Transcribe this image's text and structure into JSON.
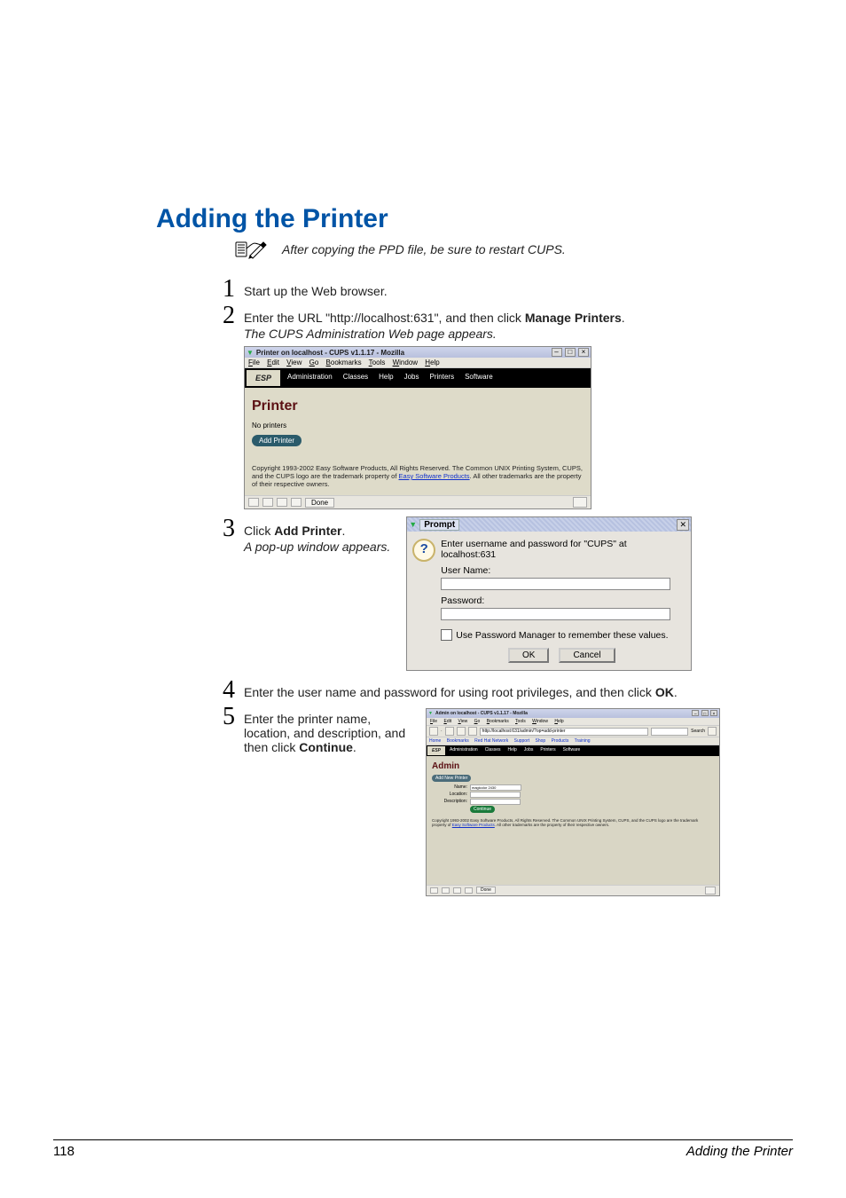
{
  "page": {
    "heading": "Adding the Printer",
    "note_after_icon": "After copying the PPD file, be sure to restart CUPS.",
    "footer_pagenum": "118",
    "footer_title": "Adding the Printer"
  },
  "steps": {
    "s1_num": "1",
    "s1_text": "Start up the Web browser.",
    "s2_num": "2",
    "s2_text_a": "Enter the URL \"http://localhost:631\", and then click ",
    "s2_bold": "Manage Printers",
    "s2_text_b": ".",
    "s2_result": "The CUPS Administration Web page appears.",
    "s3_num": "3",
    "s3_text_a": "Click ",
    "s3_bold": "Add Printer",
    "s3_text_b": ".",
    "s3_result": "A pop-up window appears.",
    "s4_num": "4",
    "s4_text_a": "Enter the user name and password for using root privileges, and then click ",
    "s4_bold": "OK",
    "s4_text_b": ".",
    "s5_num": "5",
    "s5_text_a": "Enter the printer name, location, and description, and then click ",
    "s5_bold": "Continue",
    "s5_text_b": "."
  },
  "shot1": {
    "window_title": "Printer on localhost - CUPS v1.1.17 - Mozilla",
    "menu_file": "File",
    "menu_edit": "Edit",
    "menu_view": "View",
    "menu_go": "Go",
    "menu_bookmarks": "Bookmarks",
    "menu_tools": "Tools",
    "menu_window": "Window",
    "menu_help": "Help",
    "nav_esp": "ESP",
    "nav_admin": "Administration",
    "nav_classes": "Classes",
    "nav_help": "Help",
    "nav_jobs": "Jobs",
    "nav_printers": "Printers",
    "nav_software": "Software",
    "heading": "Printer",
    "no_printers": "No printers",
    "add_btn": "Add Printer",
    "copyright_a": "Copyright 1993-2002 Easy Software Products, All Rights Reserved. The Common UNIX Printing System, CUPS, and the CUPS logo are the trademark property of ",
    "copyright_link": "Easy Software Products",
    "copyright_b": ". All other trademarks are the property of their respective owners.",
    "status_done": "Done"
  },
  "dialog": {
    "title": "Prompt",
    "close": "✕",
    "message": "Enter username and password for \"CUPS\" at localhost:631",
    "user_label": "User Name:",
    "pass_label": "Password:",
    "remember": "Use Password Manager to remember these values.",
    "ok": "OK",
    "cancel": "Cancel"
  },
  "shot2": {
    "window_title": "Admin on localhost - CUPS v1.1.17 - Mozilla",
    "menu_file": "File",
    "menu_edit": "Edit",
    "menu_view": "View",
    "menu_go": "Go",
    "menu_bookmarks": "Bookmarks",
    "menu_tools": "Tools",
    "menu_window": "Window",
    "menu_help": "Help",
    "tool_url": "http://localhost:631/admin/?op=add-printer",
    "tool_search": "Search",
    "bm_home": "Home",
    "bm_bk": "Bookmarks",
    "bm_rh": "Red Hat Network",
    "bm_sup": "Support",
    "bm_shop": "Shop",
    "bm_prod": "Products",
    "bm_train": "Training",
    "nav_esp": "ESP",
    "nav_admin": "Administration",
    "nav_classes": "Classes",
    "nav_help": "Help",
    "nav_jobs": "Jobs",
    "nav_printers": "Printers",
    "nav_software": "Software",
    "heading": "Admin",
    "pill": "Add New Printer",
    "name_label": "Name:",
    "name_value": "magicolor 2430",
    "loc_label": "Location:",
    "desc_label": "Description:",
    "continue_btn": "Continue",
    "copyright_a": "Copyright 1993-2002 Easy Software Products, All Rights Reserved. The Common UNIX Printing System, CUPS, and the CUPS logo are the trademark property of ",
    "copyright_link": "Easy Software Products",
    "copyright_b": ". All other trademarks are the property of their respective owners.",
    "status_done": "Done"
  }
}
